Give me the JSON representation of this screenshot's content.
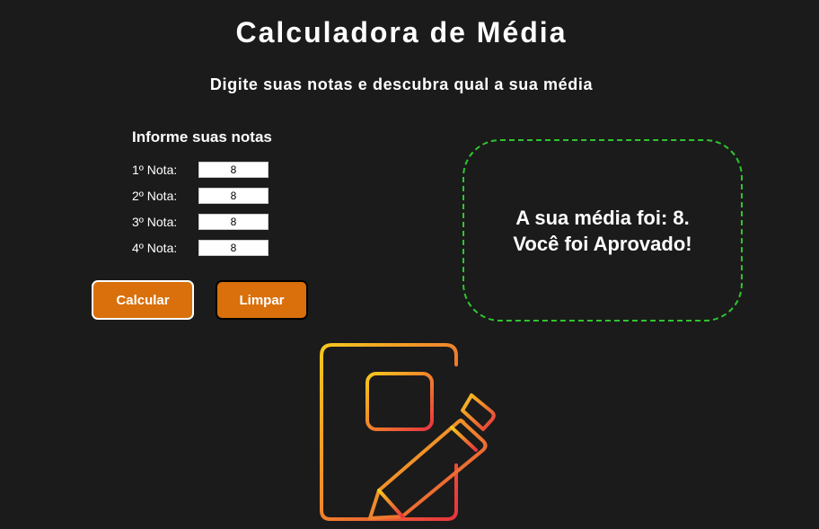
{
  "header": {
    "title": "Calculadora de Média",
    "subtitle": "Digite suas notas e descubra qual a sua média"
  },
  "form": {
    "heading": "Informe suas notas",
    "grades": [
      {
        "label": "1º Nota:",
        "value": "8"
      },
      {
        "label": "2º Nota:",
        "value": "8"
      },
      {
        "label": "3º Nota:",
        "value": "8"
      },
      {
        "label": "4º Nota:",
        "value": "8"
      }
    ],
    "buttons": {
      "calculate": "Calcular",
      "clear": "Limpar"
    }
  },
  "result": {
    "line1": "A sua média foi: 8.",
    "line2": "Você foi Aprovado!"
  },
  "illustration": {
    "icon": "notebook-pencil-icon",
    "gradient_start": "#f7c81e",
    "gradient_end": "#e8343f"
  },
  "colors": {
    "background": "#1b1b1b",
    "button": "#d9700c",
    "result_border": "#2fc52f"
  }
}
